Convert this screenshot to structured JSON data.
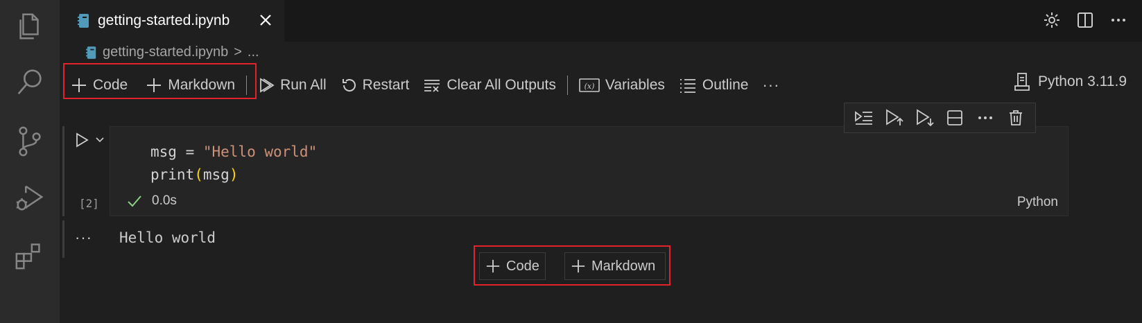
{
  "tab": {
    "label": "getting-started.ipynb"
  },
  "breadcrumb": {
    "file": "getting-started.ipynb",
    "separator": ">",
    "more": "..."
  },
  "toolbar": {
    "add_code": "Code",
    "add_markdown": "Markdown",
    "run_all": "Run All",
    "restart": "Restart",
    "clear_outputs": "Clear All Outputs",
    "variables": "Variables",
    "outline": "Outline",
    "more": "···"
  },
  "kernel": {
    "label": "Python 3.11.9"
  },
  "cell": {
    "code_line1_prefix": "msg = ",
    "code_line1_string": "\"Hello world\"",
    "code_line2_fn": "print",
    "code_line2_open": "(",
    "code_line2_arg": "msg",
    "code_line2_close": ")",
    "exec_count": "[2]",
    "duration": "0.0s",
    "language": "Python"
  },
  "output": {
    "text": "Hello world",
    "more": "···"
  },
  "insert": {
    "code": "Code",
    "markdown": "Markdown"
  },
  "colors": {
    "highlight_box": "#e3222c",
    "check": "#89d185",
    "notebook_icon": "#519aba"
  },
  "icons": {
    "activity": [
      "files-icon",
      "search-icon",
      "source-control-icon",
      "run-debug-icon",
      "extensions-icon"
    ],
    "cell_toolbar": [
      "run-by-line-icon",
      "execute-above-icon",
      "execute-below-icon",
      "split-cell-icon",
      "more-icon",
      "delete-icon"
    ]
  }
}
